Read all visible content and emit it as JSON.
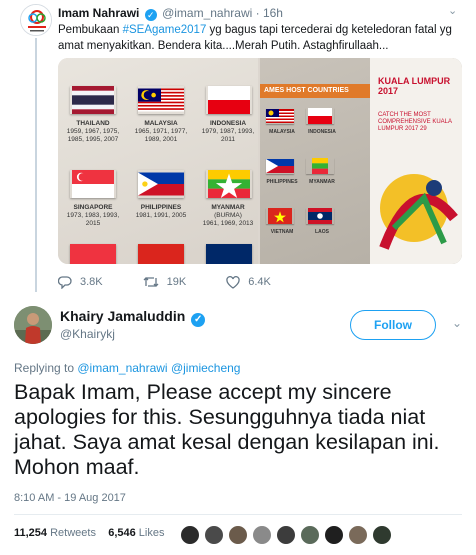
{
  "quoted": {
    "name": "Imam Nahrawi",
    "handle": "@imam_nahrawi",
    "time": "· 16h",
    "text_pre": "Pembukaan ",
    "hashtag": "#SEAgame2017",
    "text_post": " yg bagus tapi tercederai dg keteledoran fatal yg amat menyakitkan. Bendera kita....Merah Putih. Astaghfirullaah...",
    "photo_left": {
      "flags": [
        {
          "country": "THAILAND",
          "years": "1959, 1967, 1975,\n1985, 1995, 2007"
        },
        {
          "country": "MALAYSIA",
          "years": "1965, 1971, 1977,\n1989, 2001"
        },
        {
          "country": "INDONESIA",
          "years": "1979, 1987, 1993,\n2011"
        },
        {
          "country": "SINGAPORE",
          "years": "1973, 1983, 1993,\n2015"
        },
        {
          "country": "PHILIPPINES",
          "years": "1981, 1991, 2005"
        },
        {
          "country": "MYANMAR",
          "years": "(BURMA)\n1961, 1969, 2013"
        }
      ]
    },
    "photo_right": {
      "banner": "AMES HOST COUNTRIES",
      "logo": "KUALA LUMPUR 2017",
      "tagline": "CATCH THE MOST COMPREHENSIVE KUALA LUMPUR 2017 29",
      "mini_labels": [
        "MALAYSIA",
        "INDONESIA",
        "PHILIPPINES",
        "MYANMAR",
        "VIETNAM",
        "LAOS"
      ]
    },
    "stats": {
      "replies": "3.8K",
      "retweets": "19K",
      "likes": "6.4K"
    }
  },
  "main": {
    "name": "Khairy Jamaluddin",
    "handle": "@Khairykj",
    "follow_label": "Follow",
    "replying_prefix": "Replying to ",
    "replying_to_1": "@imam_nahrawi",
    "replying_to_2": "@jimiecheng",
    "text": "Bapak Imam, Please accept my sincere apologies for this. Sesungguhnya tiada niat jahat. Saya amat kesal dengan kesilapan ini. Mohon maaf.",
    "timestamp": "8:10 AM - 19 Aug 2017",
    "retweets_count": "11,254",
    "retweets_label": "Retweets",
    "likes_count": "6,546",
    "likes_label": "Likes"
  },
  "colors": {
    "accent": "#1da1f2",
    "link": "#1b95e0",
    "muted": "#657786"
  }
}
